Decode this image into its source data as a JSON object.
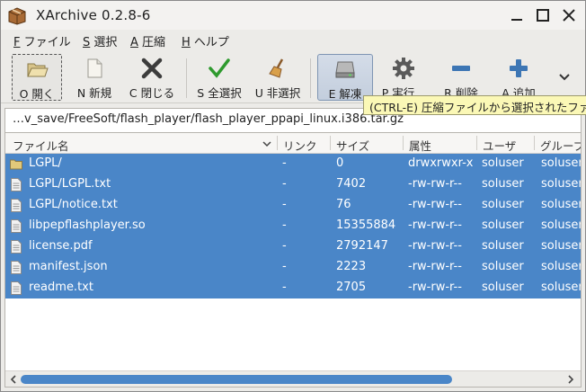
{
  "window": {
    "title": "XArchive 0.2.8-6"
  },
  "menu": [
    {
      "mnemonic": "F",
      "label": " ファイル"
    },
    {
      "mnemonic": "S",
      "label": " 選択"
    },
    {
      "mnemonic": "A",
      "label": " 圧縮"
    },
    {
      "mnemonic": "H",
      "label": " ヘルプ"
    }
  ],
  "toolbar": {
    "open": "O 開く",
    "new": "N 新規",
    "close": "C 閉じる",
    "select_all": "S 全選択",
    "unselect": "U 非選択",
    "extract": "E 解凍",
    "execute": "P 実行...",
    "delete": "R 削除",
    "add": "A 追加"
  },
  "tooltip": "(CTRL-E) 圧縮ファイルから選択されたファイ",
  "path": "…v_save/FreeSoft/flash_player/flash_player_ppapi_linux.i386.tar.gz",
  "columns": [
    "ファイル名",
    "リンク",
    "サイズ",
    "属性",
    "ユーザ",
    "グループ"
  ],
  "rows": [
    {
      "type": "folder",
      "name": "LGPL/",
      "link": "-",
      "size": "0",
      "attr": "drwxrwxr-x",
      "user": "soluser",
      "group": "soluser"
    },
    {
      "type": "file",
      "name": "LGPL/LGPL.txt",
      "link": "-",
      "size": "7402",
      "attr": "-rw-rw-r--",
      "user": "soluser",
      "group": "soluser"
    },
    {
      "type": "file",
      "name": "LGPL/notice.txt",
      "link": "-",
      "size": "76",
      "attr": "-rw-rw-r--",
      "user": "soluser",
      "group": "soluser"
    },
    {
      "type": "file",
      "name": "libpepflashplayer.so",
      "link": "-",
      "size": "15355884",
      "attr": "-rw-rw-r--",
      "user": "soluser",
      "group": "soluser"
    },
    {
      "type": "file",
      "name": "license.pdf",
      "link": "-",
      "size": "2792147",
      "attr": "-rw-rw-r--",
      "user": "soluser",
      "group": "soluser"
    },
    {
      "type": "file",
      "name": "manifest.json",
      "link": "-",
      "size": "2223",
      "attr": "-rw-rw-r--",
      "user": "soluser",
      "group": "soluser"
    },
    {
      "type": "file",
      "name": "readme.txt",
      "link": "-",
      "size": "2705",
      "attr": "-rw-rw-r--",
      "user": "soluser",
      "group": "soluser"
    }
  ],
  "colors": {
    "selection": "#4a86c8",
    "tooltip_bg": "#fbf8b6"
  },
  "icons": [
    "archive-app-icon",
    "folder-open-icon",
    "new-file-icon",
    "close-x-icon",
    "checkmark-icon",
    "broom-icon",
    "drive-icon",
    "gear-icon",
    "minus-icon",
    "plus-icon",
    "chevron-down-icon",
    "folder-icon",
    "file-icon"
  ]
}
